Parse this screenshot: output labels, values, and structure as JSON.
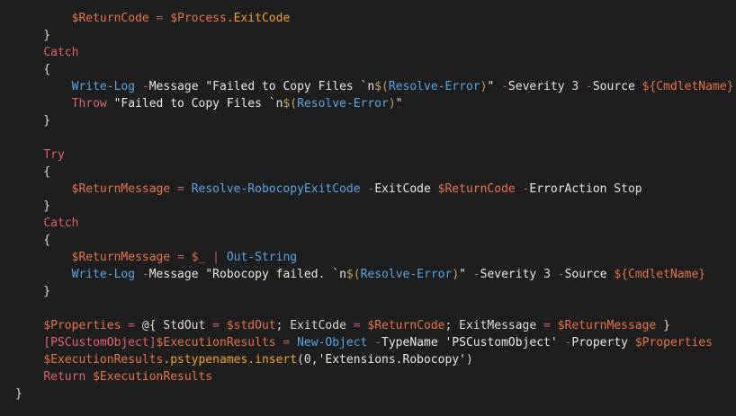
{
  "colors": {
    "background": "#1e1e1e",
    "plain": "#dcdcdc",
    "variable": "#e8734a",
    "property": "#f0a030",
    "keyword": "#e0606e",
    "command": "#58a6e8",
    "operator": "#c06070",
    "string_variable": "#c8a060",
    "type": "#e86070"
  },
  "code_lines": [
    [
      {
        "t": "        ",
        "k": "pl"
      },
      {
        "t": "$ReturnCode",
        "k": "var"
      },
      {
        "t": " = ",
        "k": "op"
      },
      {
        "t": "$Process",
        "k": "var"
      },
      {
        "t": ".ExitCode",
        "k": "prop"
      }
    ],
    [
      {
        "t": "    }",
        "k": "pl"
      }
    ],
    [
      {
        "t": "    ",
        "k": "pl"
      },
      {
        "t": "Catch",
        "k": "kw"
      }
    ],
    [
      {
        "t": "    {",
        "k": "pl"
      }
    ],
    [
      {
        "t": "        ",
        "k": "pl"
      },
      {
        "t": "Write-Log",
        "k": "cmd"
      },
      {
        "t": " -",
        "k": "op"
      },
      {
        "t": "Message",
        "k": "param"
      },
      {
        "t": " \"Failed to Copy Files `n",
        "k": "str"
      },
      {
        "t": "$(",
        "k": "strvar"
      },
      {
        "t": "Resolve-Error",
        "k": "cmd"
      },
      {
        "t": ")",
        "k": "strvar"
      },
      {
        "t": "\"",
        "k": "str"
      },
      {
        "t": " -",
        "k": "op"
      },
      {
        "t": "Severity",
        "k": "param"
      },
      {
        "t": " 3 ",
        "k": "num"
      },
      {
        "t": "-",
        "k": "op"
      },
      {
        "t": "Source",
        "k": "param"
      },
      {
        "t": " ",
        "k": "pl"
      },
      {
        "t": "${CmdletName}",
        "k": "var"
      }
    ],
    [
      {
        "t": "        ",
        "k": "pl"
      },
      {
        "t": "Throw",
        "k": "kw"
      },
      {
        "t": " \"Failed to Copy Files `n",
        "k": "str"
      },
      {
        "t": "$(",
        "k": "strvar"
      },
      {
        "t": "Resolve-Error",
        "k": "cmd"
      },
      {
        "t": ")",
        "k": "strvar"
      },
      {
        "t": "\"",
        "k": "str"
      }
    ],
    [
      {
        "t": "    }",
        "k": "pl"
      }
    ],
    [
      {
        "t": "",
        "k": "pl"
      }
    ],
    [
      {
        "t": "    ",
        "k": "pl"
      },
      {
        "t": "Try",
        "k": "kw"
      }
    ],
    [
      {
        "t": "    {",
        "k": "pl"
      }
    ],
    [
      {
        "t": "        ",
        "k": "pl"
      },
      {
        "t": "$ReturnMessage",
        "k": "var"
      },
      {
        "t": " = ",
        "k": "op"
      },
      {
        "t": "Resolve-RobocopyExitCode",
        "k": "cmd"
      },
      {
        "t": " -",
        "k": "op"
      },
      {
        "t": "ExitCode",
        "k": "param"
      },
      {
        "t": " ",
        "k": "pl"
      },
      {
        "t": "$ReturnCode",
        "k": "var"
      },
      {
        "t": " -",
        "k": "op"
      },
      {
        "t": "ErrorAction",
        "k": "param"
      },
      {
        "t": " Stop",
        "k": "pl"
      }
    ],
    [
      {
        "t": "    }",
        "k": "pl"
      }
    ],
    [
      {
        "t": "    ",
        "k": "pl"
      },
      {
        "t": "Catch",
        "k": "kw"
      }
    ],
    [
      {
        "t": "    {",
        "k": "pl"
      }
    ],
    [
      {
        "t": "        ",
        "k": "pl"
      },
      {
        "t": "$ReturnMessage",
        "k": "var"
      },
      {
        "t": " = ",
        "k": "op"
      },
      {
        "t": "$_",
        "k": "var"
      },
      {
        "t": " | ",
        "k": "op"
      },
      {
        "t": "Out-String",
        "k": "cmd"
      }
    ],
    [
      {
        "t": "        ",
        "k": "pl"
      },
      {
        "t": "Write-Log",
        "k": "cmd"
      },
      {
        "t": " -",
        "k": "op"
      },
      {
        "t": "Message",
        "k": "param"
      },
      {
        "t": " \"Robocopy failed. `n",
        "k": "str"
      },
      {
        "t": "$(",
        "k": "strvar"
      },
      {
        "t": "Resolve-Error",
        "k": "cmd"
      },
      {
        "t": ")",
        "k": "strvar"
      },
      {
        "t": "\"",
        "k": "str"
      },
      {
        "t": " -",
        "k": "op"
      },
      {
        "t": "Severity",
        "k": "param"
      },
      {
        "t": " 3 ",
        "k": "num"
      },
      {
        "t": "-",
        "k": "op"
      },
      {
        "t": "Source",
        "k": "param"
      },
      {
        "t": " ",
        "k": "pl"
      },
      {
        "t": "${CmdletName}",
        "k": "var"
      }
    ],
    [
      {
        "t": "    }",
        "k": "pl"
      }
    ],
    [
      {
        "t": "",
        "k": "pl"
      }
    ],
    [
      {
        "t": "    ",
        "k": "pl"
      },
      {
        "t": "$Properties",
        "k": "var"
      },
      {
        "t": " = ",
        "k": "op"
      },
      {
        "t": "@{ StdOut ",
        "k": "pl"
      },
      {
        "t": "= ",
        "k": "op"
      },
      {
        "t": "$stdOut",
        "k": "var"
      },
      {
        "t": "; ExitCode ",
        "k": "pl"
      },
      {
        "t": "= ",
        "k": "op"
      },
      {
        "t": "$ReturnCode",
        "k": "var"
      },
      {
        "t": "; ExitMessage ",
        "k": "pl"
      },
      {
        "t": "= ",
        "k": "op"
      },
      {
        "t": "$ReturnMessage",
        "k": "var"
      },
      {
        "t": " }",
        "k": "pl"
      }
    ],
    [
      {
        "t": "    ",
        "k": "pl"
      },
      {
        "t": "[PSCustomObject]",
        "k": "type"
      },
      {
        "t": "$ExecutionResults",
        "k": "var"
      },
      {
        "t": " = ",
        "k": "op"
      },
      {
        "t": "New-Object",
        "k": "cmd"
      },
      {
        "t": " -",
        "k": "op"
      },
      {
        "t": "TypeName",
        "k": "param"
      },
      {
        "t": " 'PSCustomObject'",
        "k": "str"
      },
      {
        "t": " -",
        "k": "op"
      },
      {
        "t": "Property",
        "k": "param"
      },
      {
        "t": " ",
        "k": "pl"
      },
      {
        "t": "$Properties",
        "k": "var"
      }
    ],
    [
      {
        "t": "    ",
        "k": "pl"
      },
      {
        "t": "$ExecutionResults",
        "k": "var"
      },
      {
        "t": ".pstypenames.insert",
        "k": "prop"
      },
      {
        "t": "(0,",
        "k": "pl"
      },
      {
        "t": "'Extensions.Robocopy'",
        "k": "str"
      },
      {
        "t": ")",
        "k": "pl"
      }
    ],
    [
      {
        "t": "    ",
        "k": "pl"
      },
      {
        "t": "Return",
        "k": "kw"
      },
      {
        "t": " ",
        "k": "pl"
      },
      {
        "t": "$ExecutionResults",
        "k": "var"
      }
    ],
    [
      {
        "t": "}",
        "k": "pl"
      }
    ]
  ]
}
